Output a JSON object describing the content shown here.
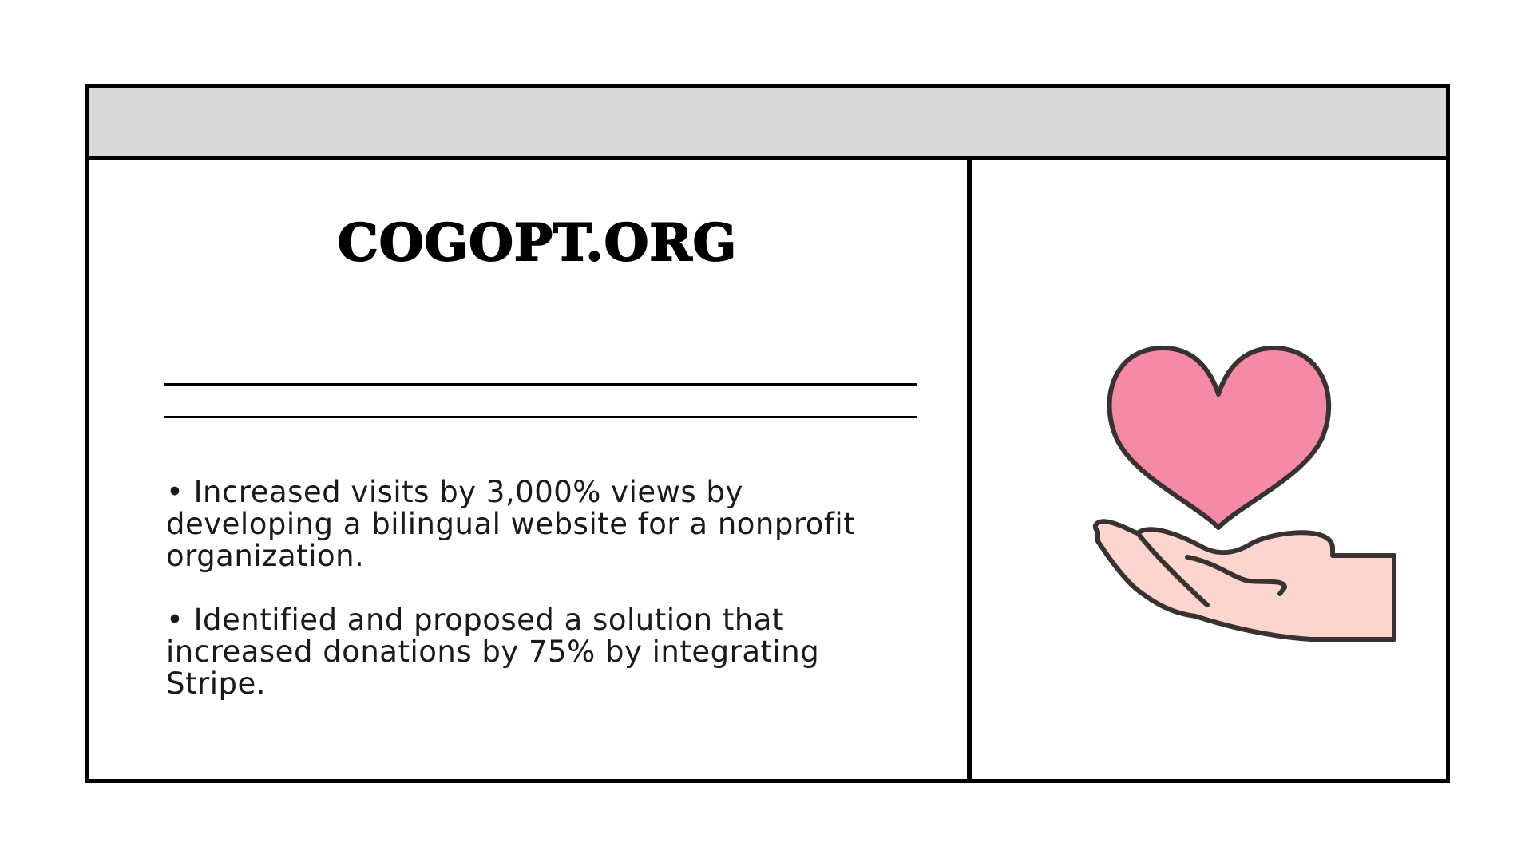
{
  "card": {
    "title": "COGOPT.ORG",
    "bullets": [
      "Increased visits by 3,000% views by developing a bilingual website for a nonprofit organization.",
      "Identified and proposed a solution that increased donations by 75% by integrating Stripe."
    ]
  },
  "illustration": {
    "icon": "heart-in-hand-icon",
    "colors": {
      "heart": "#f48aa6",
      "hand": "#fdd5cf",
      "outline": "#3a3230"
    }
  },
  "colors": {
    "header_bar": "#d9d9d9",
    "border": "#000000",
    "background": "#ffffff"
  }
}
